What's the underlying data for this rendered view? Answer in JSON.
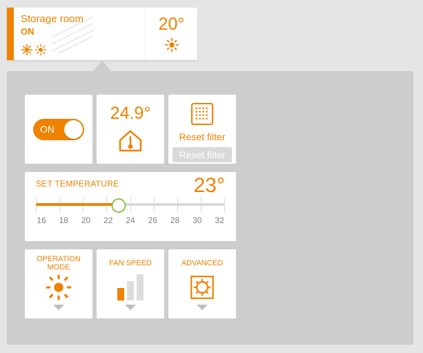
{
  "header": {
    "room_name": "Storage room",
    "state": "ON",
    "current_temp": "20°"
  },
  "panel": {
    "power": {
      "label": "ON",
      "on": true
    },
    "room_temp": "24.9°",
    "filter": {
      "label": "Reset filter",
      "button": "Reset filter"
    },
    "set_temp": {
      "title": "SET TEMPERATURE",
      "value": "23°",
      "min": 16,
      "max": 32,
      "current": 23,
      "ticks": [
        "16",
        "18",
        "20",
        "22",
        "24",
        "26",
        "28",
        "30",
        "32"
      ]
    },
    "mode": {
      "title": "OPERATION MODE"
    },
    "fan": {
      "title": "FAN SPEED",
      "level": 1,
      "max_level": 3
    },
    "advanced": {
      "title": "ADVANCED"
    }
  },
  "colors": {
    "accent": "#ef8200"
  }
}
